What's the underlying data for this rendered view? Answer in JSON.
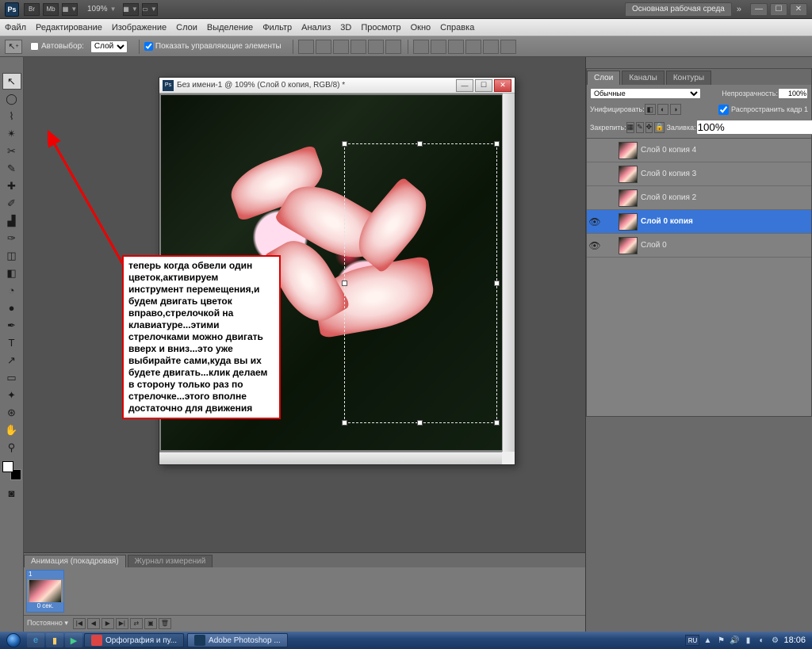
{
  "appbar": {
    "logo": "Ps",
    "icons": [
      "Br",
      "Mb",
      "■",
      "▦"
    ],
    "zoom": "109%",
    "workspace_label": "Основная рабочая среда",
    "chevrons": "»"
  },
  "menubar": [
    "Файл",
    "Редактирование",
    "Изображение",
    "Слои",
    "Выделение",
    "Фильтр",
    "Анализ",
    "3D",
    "Просмотр",
    "Окно",
    "Справка"
  ],
  "optbar": {
    "autoselect_label": "Автовыбор:",
    "autoselect_value": "Слой",
    "show_controls_label": "Показать управляющие элементы"
  },
  "doc": {
    "title": "Без имени-1 @ 109% (Слой 0 копия, RGB/8) *"
  },
  "tooltip": "теперь когда обвели один цветок,активируем инструмент перемещения,и будем двигать цветок вправо,стрелочкой на клавиатуре...этими стрелочками можно двигать вверх и вниз...это уже выбирайте сами,куда вы их будете двигать...клик делаем в сторону только раз по стрелочке...этого вполне достаточно для движения",
  "layers_panel": {
    "tabs": [
      "Слои",
      "Каналы",
      "Контуры"
    ],
    "blend_mode": "Обычные",
    "opacity_label": "Непрозрачность:",
    "opacity_value": "100%",
    "unify_label": "Унифицировать:",
    "propagate_label": "Распространить кадр 1",
    "lock_label": "Закрепить:",
    "fill_label": "Заливка:",
    "fill_value": "100%",
    "layers": [
      {
        "name": "Слой 0 копия 4",
        "visible": false,
        "selected": false
      },
      {
        "name": "Слой 0 копия 3",
        "visible": false,
        "selected": false
      },
      {
        "name": "Слой 0 копия 2",
        "visible": false,
        "selected": false
      },
      {
        "name": "Слой 0 копия",
        "visible": true,
        "selected": true
      },
      {
        "name": "Слой 0",
        "visible": true,
        "selected": false
      }
    ]
  },
  "animation": {
    "tabs": [
      "Анимация (покадровая)",
      "Журнал измерений"
    ],
    "frames": [
      {
        "num": "1",
        "duration": "0 сек."
      }
    ],
    "loop": "Постоянно"
  },
  "taskbar": {
    "items": [
      {
        "label": "Орфография и пу...",
        "active": false,
        "color": "#d44"
      },
      {
        "label": "Adobe Photoshop ...",
        "active": true,
        "color": "#1a3a5a"
      }
    ],
    "lang": "RU",
    "clock": "18:06"
  },
  "tool_glyphs": [
    "▲",
    "◯",
    "⊞",
    "✂",
    "✎",
    "✐",
    "▭",
    "⌫",
    "◔",
    "●",
    "◧",
    "▥",
    "⬚",
    "✒",
    "⌨",
    "✥",
    "✦",
    "⊕",
    "◷",
    "✋",
    "⚲"
  ]
}
